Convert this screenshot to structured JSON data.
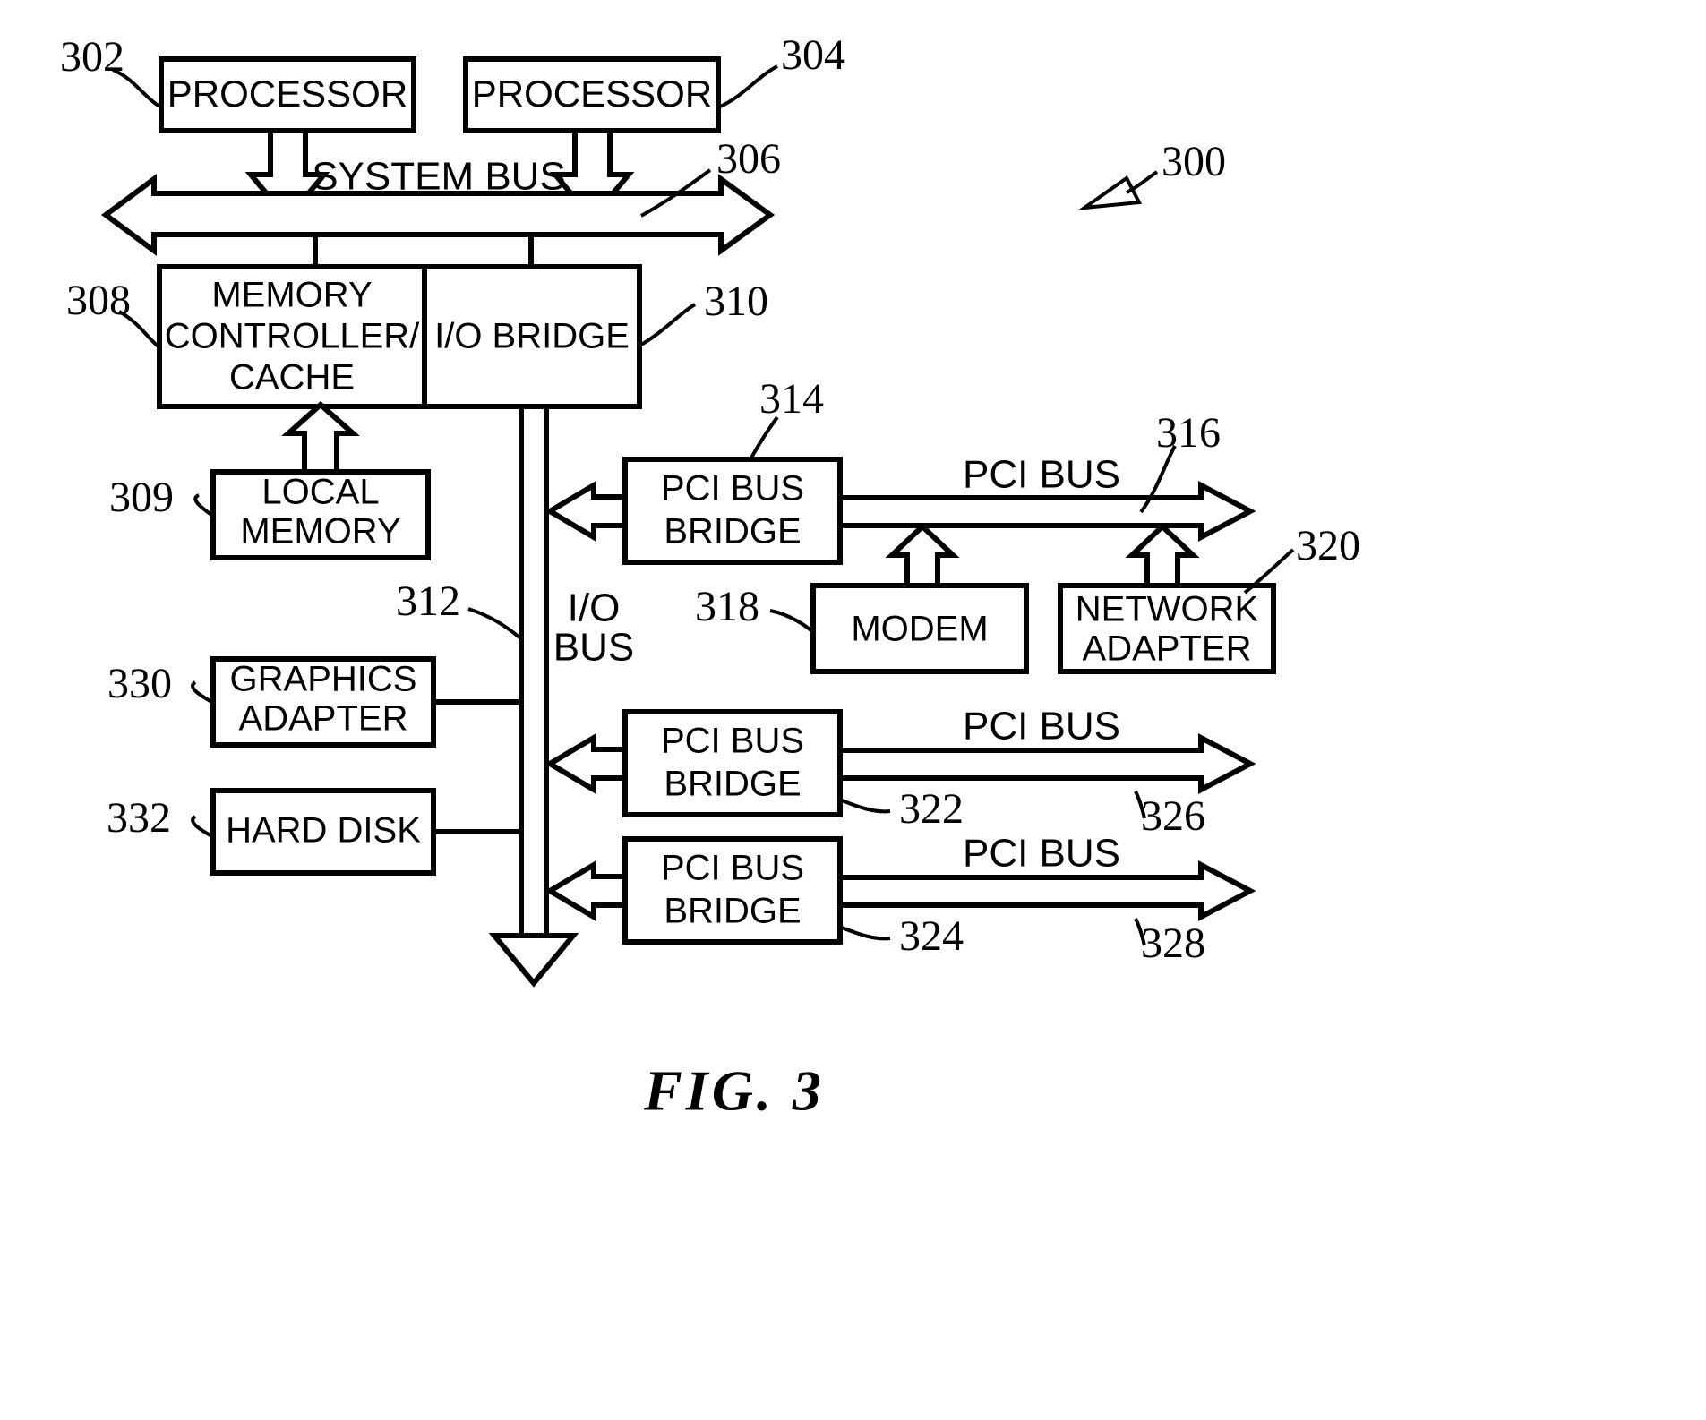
{
  "figure": {
    "caption": "FIG.  3",
    "system_ref": "300"
  },
  "blocks": {
    "processor_1": {
      "label": "PROCESSOR",
      "ref": "302"
    },
    "processor_2": {
      "label": "PROCESSOR",
      "ref": "304"
    },
    "memory_controller": {
      "line1": "MEMORY",
      "line2": "CONTROLLER/",
      "line3": "CACHE",
      "ref": "308"
    },
    "io_bridge": {
      "label": "I/O BRIDGE",
      "ref": "310"
    },
    "local_memory": {
      "line1": "LOCAL",
      "line2": "MEMORY",
      "ref": "309"
    },
    "graphics_adapter": {
      "line1": "GRAPHICS",
      "line2": "ADAPTER",
      "ref": "330"
    },
    "hard_disk": {
      "label": "HARD DISK",
      "ref": "332"
    },
    "pci_bus_bridge_1": {
      "line1": "PCI BUS",
      "line2": "BRIDGE",
      "ref": "314"
    },
    "pci_bus_bridge_2": {
      "line1": "PCI BUS",
      "line2": "BRIDGE",
      "ref": "322"
    },
    "pci_bus_bridge_3": {
      "line1": "PCI BUS",
      "line2": "BRIDGE",
      "ref": "324"
    },
    "modem": {
      "label": "MODEM",
      "ref": "318"
    },
    "network_adapter": {
      "line1": "NETWORK",
      "line2": "ADAPTER",
      "ref": "320"
    }
  },
  "buses": {
    "system_bus": {
      "label": "SYSTEM BUS",
      "ref": "306"
    },
    "io_bus": {
      "line1": "I/O",
      "line2": "BUS",
      "ref": "312"
    },
    "pci_bus_1": {
      "label": "PCI BUS",
      "ref": "316"
    },
    "pci_bus_2": {
      "label": "PCI BUS",
      "ref": "326"
    },
    "pci_bus_3": {
      "label": "PCI BUS",
      "ref": "328"
    }
  },
  "colors": {
    "ink": "#000000",
    "paper": "#ffffff"
  }
}
